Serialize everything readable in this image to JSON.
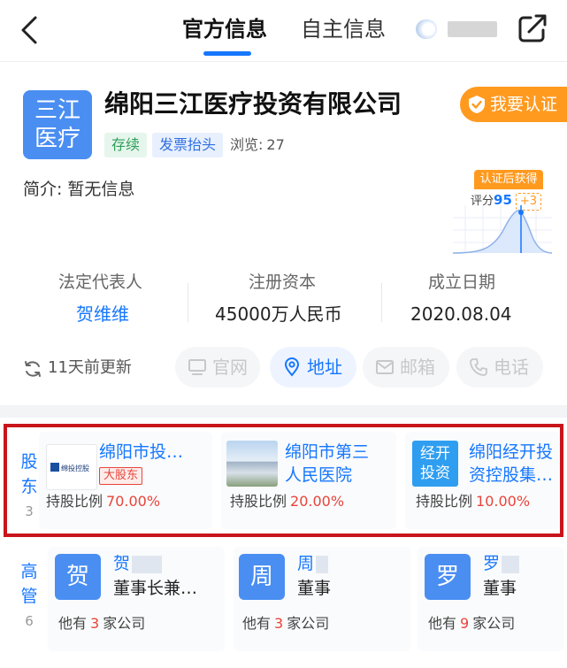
{
  "nav": {
    "tab_official": "官方信息",
    "tab_self": "自主信息"
  },
  "company": {
    "logo_line1": "三江",
    "logo_line2": "医疗",
    "name": "绵阳三江医疗投资有限公司",
    "certify_label": "我要认证",
    "tag_status": "存续",
    "tag_invoice": "发票抬头",
    "views_label": "浏览:",
    "views_count": "27",
    "intro_label": "简介:",
    "intro_value": "暂无信息"
  },
  "score": {
    "badge": "认证后获得",
    "label": "评分",
    "value": "95",
    "bonus": "+3"
  },
  "key_info": {
    "legal_rep_label": "法定代表人",
    "legal_rep_value": "贺维维",
    "capital_label": "注册资本",
    "capital_value": "45000万人民币",
    "founded_label": "成立日期",
    "founded_value": "2020.08.04"
  },
  "update_text": "11天前更新",
  "contact": {
    "website": "官网",
    "address": "地址",
    "email": "邮箱",
    "phone": "电话"
  },
  "shareholders": {
    "label_a": "股",
    "label_b": "东",
    "count": "3",
    "ratio_label": "持股比例",
    "items": [
      {
        "name": "绵阳市投…",
        "tag": "大股东",
        "ratio": "70.00%",
        "logo_text": "绵投控股"
      },
      {
        "name_line1": "绵阳市第三",
        "name_line2": "人民医院",
        "ratio": "20.00%"
      },
      {
        "logo_line1": "经开",
        "logo_line2": "投资",
        "name_line1": "绵阳经开投",
        "name_line2": "资控股集…",
        "ratio": "10.00%"
      }
    ]
  },
  "executives": {
    "label_a": "高",
    "label_b": "管",
    "count": "6",
    "prefix": "他有",
    "suffix": "家公司",
    "items": [
      {
        "avatar": "贺",
        "name": "贺",
        "role": "董事长兼…",
        "companies": "3"
      },
      {
        "avatar": "周",
        "name": "周",
        "role": "董事",
        "companies": "3"
      },
      {
        "avatar": "罗",
        "name": "罗",
        "role": "董事",
        "companies": "9"
      }
    ]
  },
  "colors": {
    "accent": "#1677ff",
    "orange": "#ff9a1f",
    "highlight": "#c8151b",
    "percent": "#e8443a"
  }
}
